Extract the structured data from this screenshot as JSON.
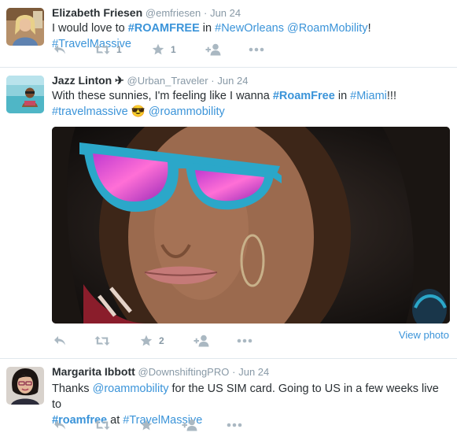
{
  "tweets": [
    {
      "name": "Elizabeth Friesen",
      "handle": "@emfriesen",
      "sep": "·",
      "date": "Jun 24",
      "text": {
        "t1": "I would love to ",
        "hash1": "#ROAMFREE",
        "t2": " in ",
        "hash2": "#NewOrleans",
        "t3": " ",
        "mention1": "@RoamMobility",
        "t4": "! ",
        "hash3": "#TravelMassive"
      },
      "retweets": "1",
      "favorites": "1"
    },
    {
      "name": "Jazz Linton",
      "plane": "✈",
      "handle": "@Urban_Traveler",
      "sep": "·",
      "date": "Jun 24",
      "text": {
        "t1": "With these sunnies, I'm feeling like I wanna ",
        "hash1": "#RoamFree",
        "t2": " in ",
        "hash2": "#Miami",
        "t3": "!!!",
        "hash3": "#travelmassive",
        "emoji": "😎",
        "mention1": "@roammobility"
      },
      "retweets": "",
      "favorites": "2",
      "view_photo": "View photo"
    },
    {
      "name": "Margarita Ibbott",
      "handle": "@DownshiftingPRO",
      "sep": "·",
      "date": "Jun 24",
      "text": {
        "t1": "Thanks ",
        "mention1": "@roammobility",
        "t2": " for the US SIM card. Going to US in a few weeks live to",
        "hash1": "#roamfree",
        "t3": " at ",
        "hash2": "#TravelMassive"
      },
      "retweets": "",
      "favorites": ""
    }
  ],
  "icons": [
    "reply-icon",
    "retweet-icon",
    "favorite-icon",
    "follow-icon",
    "more-icon"
  ],
  "colors": {
    "link": "#3b94d9",
    "meta": "#8899a6",
    "action": "#aab8c2",
    "name": "#292f33"
  }
}
